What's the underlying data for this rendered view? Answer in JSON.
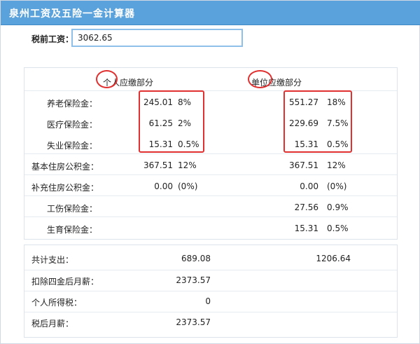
{
  "app": {
    "title": "泉州工资及五险一金计算器"
  },
  "salary": {
    "label": "税前工资：",
    "value": "3062.65"
  },
  "headers": {
    "personal": "个人应缴部分",
    "company": "单位应缴部分"
  },
  "rows": [
    {
      "label": "养老保险金：",
      "personal_amount": "245.01",
      "personal_rate": "8%",
      "company_amount": "551.27",
      "company_rate": "18%"
    },
    {
      "label": "医疗保险金：",
      "personal_amount": "61.25",
      "personal_rate": "2%",
      "company_amount": "229.69",
      "company_rate": "7.5%"
    },
    {
      "label": "失业保险金：",
      "personal_amount": "15.31",
      "personal_rate": "0.5%",
      "company_amount": "15.31",
      "company_rate": "0.5%"
    },
    {
      "label": "基本住房公积金：",
      "personal_amount": "367.51",
      "personal_rate": "12%",
      "company_amount": "367.51",
      "company_rate": "12%"
    },
    {
      "label": "补充住房公积金：",
      "personal_amount": "0.00",
      "personal_rate": "(0%)",
      "company_amount": "0.00",
      "company_rate": "(0%)"
    },
    {
      "label": "工伤保险金：",
      "personal_amount": "",
      "personal_rate": "",
      "company_amount": "27.56",
      "company_rate": "0.9%"
    },
    {
      "label": "生育保险金：",
      "personal_amount": "",
      "personal_rate": "",
      "company_amount": "15.31",
      "company_rate": "0.5%"
    }
  ],
  "summary": [
    {
      "label": "共计支出：",
      "personal": "689.08",
      "company": "1206.64"
    },
    {
      "label": "扣除四金后月薪：",
      "personal": "2373.57",
      "company": ""
    },
    {
      "label": "个人所得税：",
      "personal": "0",
      "company": ""
    },
    {
      "label": "税后月薪：",
      "personal": "2373.57",
      "company": ""
    }
  ],
  "colors": {
    "accent": "#5aa2db",
    "highlight": "#e03030"
  }
}
